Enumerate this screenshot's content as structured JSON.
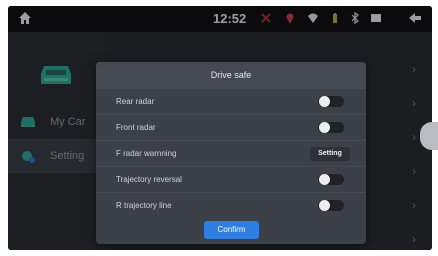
{
  "statusbar": {
    "time": "12:52",
    "icons": [
      "home-icon",
      "signal-muted-icon",
      "location-off-icon",
      "wifi-icon",
      "battery-icon",
      "bluetooth-icon",
      "window-icon",
      "back-arrow-icon"
    ]
  },
  "sidebar": {
    "items": [
      {
        "label": "My Car",
        "icon": "car-icon"
      },
      {
        "label": "Setting",
        "icon": "gear-car-icon",
        "active": true
      }
    ]
  },
  "dialog": {
    "title": "Drive safe",
    "rows": [
      {
        "label": "Rear radar",
        "control": "toggle",
        "on": false
      },
      {
        "label": "Front radar",
        "control": "toggle",
        "on": false
      },
      {
        "label": "F radar warnning",
        "control": "button",
        "button_label": "Setting"
      },
      {
        "label": "Trajectory reversal",
        "control": "toggle",
        "on": false
      },
      {
        "label": "R trajectory line",
        "control": "toggle",
        "on": false
      }
    ],
    "confirm_label": "Confirm"
  },
  "colors": {
    "accent": "#2d7de3",
    "background": "#26292e",
    "dialog": "#3c4047"
  }
}
